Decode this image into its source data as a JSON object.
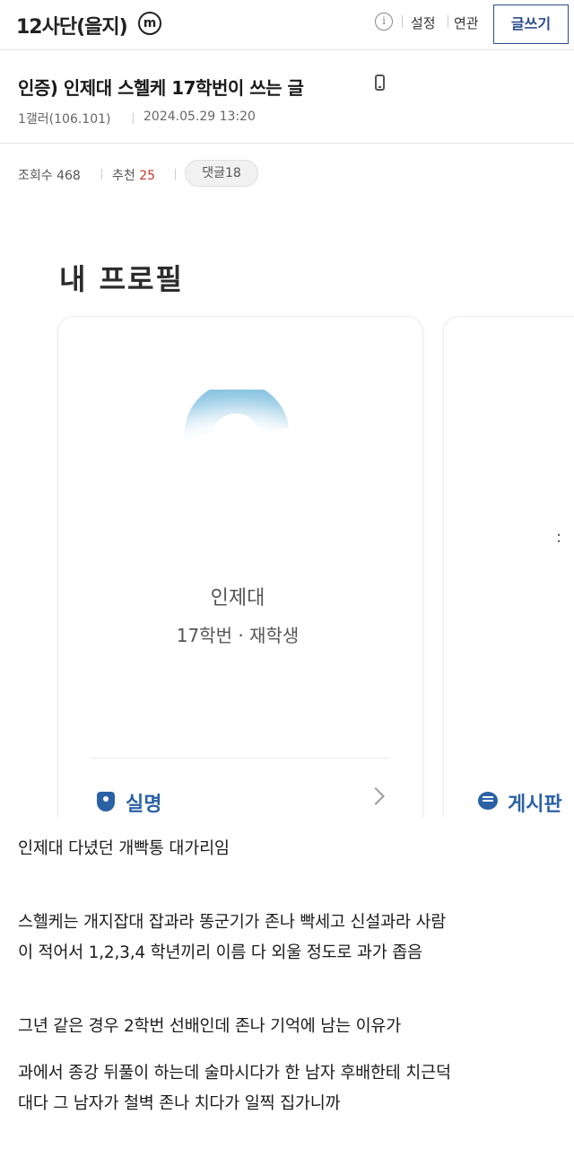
{
  "header": {
    "gallery_title": "12사단(을지)",
    "minor_badge": "m",
    "info_icon": "i",
    "settings_label": "설정",
    "related_label": "연관",
    "write_label": "글쓰기"
  },
  "post": {
    "title": "인증) 인제대 스헬케 17학번이 쓰는 글",
    "author": "1갤러(106.101)",
    "date": "2024.05.29 13:20",
    "views_label": "조회수",
    "views": "468",
    "recommend_label": "추천",
    "recommend": "25",
    "comments_label": "댓글",
    "comments": "18"
  },
  "screenshot": {
    "heading": "내 프로필",
    "university": "인제대",
    "grade_status": "17학번 · 재학생",
    "verified_label": "실명",
    "board_label": "게시판",
    "colon_glyph": ":",
    "accent_color": "#2b62a6",
    "arc_color": "#7fbfe0"
  },
  "body": {
    "p1": "인제대 다녔던 개빡통 대가리임",
    "p2_line1": "스헬케는 개지잡대 잡과라 똥군기가 존나 빡세고 신설과라 사람",
    "p2_line2": "이 적어서 1,2,3,4 학년끼리 이름 다 외울 정도로 과가 좁음",
    "p3": "그년 같은 경우 2학번 선배인데 존나 기억에 남는 이유가",
    "p4_line1": "과에서 종강 뒤풀이 하는데 술마시다가 한 남자 후배한테 치근덕",
    "p4_line2": "대다 그 남자가 철벽 존나 치다가 일찍 집가니까"
  }
}
